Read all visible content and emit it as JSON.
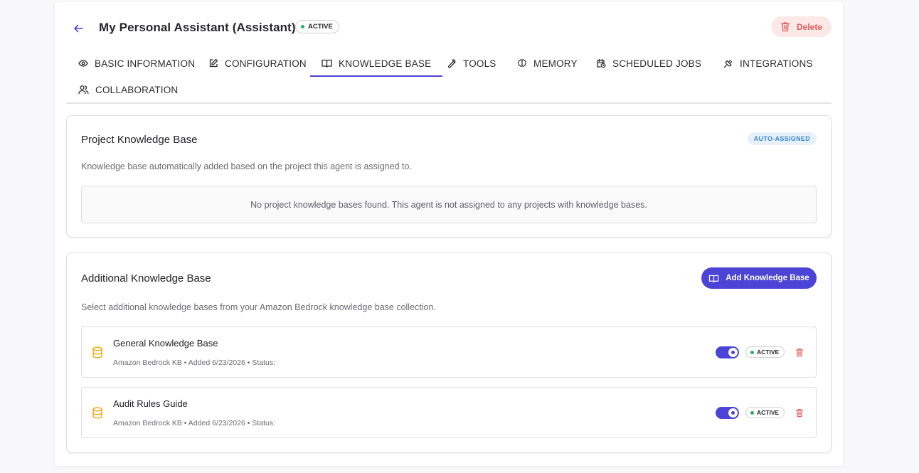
{
  "header": {
    "title": "My Personal Assistant (Assistant)",
    "status": "ACTIVE",
    "delete_label": "Delete"
  },
  "tabs": [
    {
      "label": "BASIC INFORMATION",
      "icon": "eye-icon"
    },
    {
      "label": "CONFIGURATION",
      "icon": "edit-icon"
    },
    {
      "label": "KNOWLEDGE BASE",
      "icon": "book-icon",
      "active": true
    },
    {
      "label": "TOOLS",
      "icon": "wrench-icon"
    },
    {
      "label": "MEMORY",
      "icon": "brain-icon"
    },
    {
      "label": "SCHEDULED JOBS",
      "icon": "calendar-clock-icon"
    },
    {
      "label": "INTEGRATIONS",
      "icon": "plug-icon"
    },
    {
      "label": "COLLABORATION",
      "icon": "users-icon"
    }
  ],
  "project_kb": {
    "title": "Project Knowledge Base",
    "badge": "AUTO-ASSIGNED",
    "description": "Knowledge base automatically added based on the project this agent is assigned to.",
    "empty_message": "No project knowledge bases found. This agent is not assigned to any projects with knowledge bases."
  },
  "additional_kb": {
    "title": "Additional Knowledge Base",
    "add_label": "Add Knowledge Base",
    "description": "Select additional knowledge bases from your Amazon Bedrock knowledge base collection.",
    "items": [
      {
        "name": "General Knowledge Base",
        "meta": "Amazon Bedrock KB • Added 6/23/2026 • Status:",
        "status": "ACTIVE",
        "enabled": true
      },
      {
        "name": "Audit Rules Guide",
        "meta": "Amazon Bedrock KB • Added 6/23/2026 • Status:",
        "status": "ACTIVE",
        "enabled": true
      }
    ]
  },
  "colors": {
    "accent": "#4b44d6",
    "danger": "#e25b5b",
    "danger_bg": "#fde8e8",
    "success": "#22b35e",
    "info": "#3d86cf",
    "kb_icon": "#f0a30a"
  }
}
